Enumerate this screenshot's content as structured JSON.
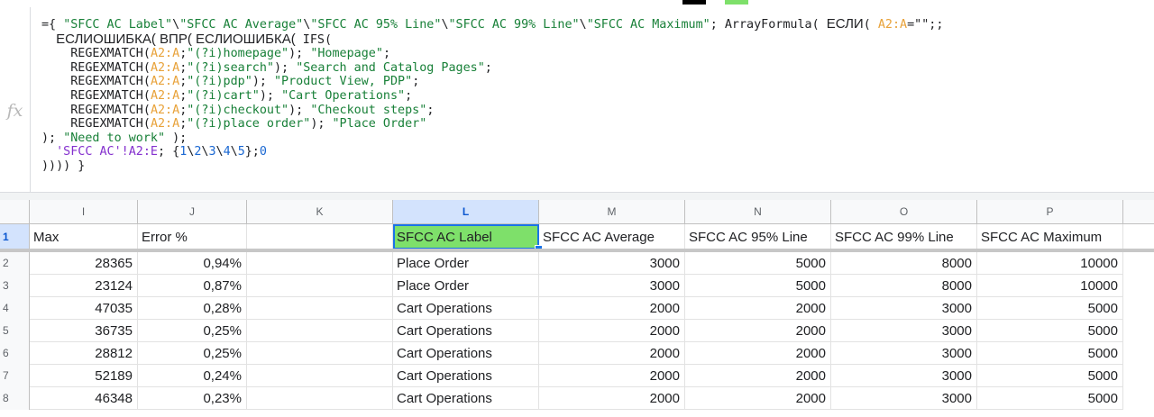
{
  "toolbar": {
    "marks": [
      {
        "name": "toolbar-black-swatch",
        "color": "#000000"
      },
      {
        "name": "toolbar-green-swatch",
        "color": "#7ee06a"
      }
    ]
  },
  "formula_bar": {
    "fx_label": "fx",
    "lines": [
      [
        {
          "t": "={ "
        },
        {
          "t": "\"SFCC AC Label\"",
          "c": "str"
        },
        {
          "t": "\\"
        },
        {
          "t": "\"SFCC AC Average\"",
          "c": "str"
        },
        {
          "t": "\\"
        },
        {
          "t": "\"SFCC AC 95% Line\"",
          "c": "str"
        },
        {
          "t": "\\"
        },
        {
          "t": "\"SFCC AC 99% Line\"",
          "c": "str"
        },
        {
          "t": "\\"
        },
        {
          "t": "\"SFCC AC Maximum\"",
          "c": "str"
        },
        {
          "t": "; ArrayFormula( "
        },
        {
          "t": "ЕСЛИ",
          "c": "cy"
        },
        {
          "t": "( "
        },
        {
          "t": "A2:A",
          "c": "ref"
        },
        {
          "t": "=\"\";;"
        }
      ],
      [
        {
          "t": "  "
        },
        {
          "t": "ЕСЛИОШИБКА( ВПР( ЕСЛИОШИБКА(",
          "c": "cy"
        },
        {
          "t": " IFS("
        }
      ],
      [
        {
          "t": "    REGEXMATCH("
        },
        {
          "t": "A2:A",
          "c": "ref"
        },
        {
          "t": ";"
        },
        {
          "t": "\"(?i)homepage\"",
          "c": "str"
        },
        {
          "t": "); "
        },
        {
          "t": "\"Homepage\"",
          "c": "str"
        },
        {
          "t": ";"
        }
      ],
      [
        {
          "t": "    REGEXMATCH("
        },
        {
          "t": "A2:A",
          "c": "ref"
        },
        {
          "t": ";"
        },
        {
          "t": "\"(?i)search\"",
          "c": "str"
        },
        {
          "t": "); "
        },
        {
          "t": "\"Search and Catalog Pages\"",
          "c": "str"
        },
        {
          "t": ";"
        }
      ],
      [
        {
          "t": "    REGEXMATCH("
        },
        {
          "t": "A2:A",
          "c": "ref"
        },
        {
          "t": ";"
        },
        {
          "t": "\"(?i)pdp\"",
          "c": "str"
        },
        {
          "t": "); "
        },
        {
          "t": "\"Product View, PDP\"",
          "c": "str"
        },
        {
          "t": ";"
        }
      ],
      [
        {
          "t": "    REGEXMATCH("
        },
        {
          "t": "A2:A",
          "c": "ref"
        },
        {
          "t": ";"
        },
        {
          "t": "\"(?i)cart\"",
          "c": "str"
        },
        {
          "t": "); "
        },
        {
          "t": "\"Cart Operations\"",
          "c": "str"
        },
        {
          "t": ";"
        }
      ],
      [
        {
          "t": "    REGEXMATCH("
        },
        {
          "t": "A2:A",
          "c": "ref"
        },
        {
          "t": ";"
        },
        {
          "t": "\"(?i)checkout\"",
          "c": "str"
        },
        {
          "t": "); "
        },
        {
          "t": "\"Checkout steps\"",
          "c": "str"
        },
        {
          "t": ";"
        }
      ],
      [
        {
          "t": "    REGEXMATCH("
        },
        {
          "t": "A2:A",
          "c": "ref"
        },
        {
          "t": ";"
        },
        {
          "t": "\"(?i)place order\"",
          "c": "str"
        },
        {
          "t": "); "
        },
        {
          "t": "\"Place Order\"",
          "c": "str"
        }
      ],
      [
        {
          "t": "); "
        },
        {
          "t": "\"Need to work\"",
          "c": "str"
        },
        {
          "t": " );"
        }
      ],
      [
        {
          "t": "  "
        },
        {
          "t": "'SFCC AC'!A2:E",
          "c": "sheet"
        },
        {
          "t": "; {"
        },
        {
          "t": "1",
          "c": "num"
        },
        {
          "t": "\\"
        },
        {
          "t": "2",
          "c": "num"
        },
        {
          "t": "\\"
        },
        {
          "t": "3",
          "c": "num"
        },
        {
          "t": "\\"
        },
        {
          "t": "4",
          "c": "num"
        },
        {
          "t": "\\"
        },
        {
          "t": "5",
          "c": "num"
        },
        {
          "t": "};"
        },
        {
          "t": "0",
          "c": "num"
        }
      ],
      [
        {
          "t": ")))) }"
        }
      ]
    ]
  },
  "sheet": {
    "columns": [
      {
        "id": "I",
        "label": "I"
      },
      {
        "id": "J",
        "label": "J"
      },
      {
        "id": "K",
        "label": "K"
      },
      {
        "id": "L",
        "label": "L",
        "selected": true
      },
      {
        "id": "M",
        "label": "M"
      },
      {
        "id": "N",
        "label": "N"
      },
      {
        "id": "O",
        "label": "O"
      },
      {
        "id": "P",
        "label": "P"
      }
    ],
    "selected_cell": "L1",
    "selected_fill": "#7ee06a",
    "rows": [
      {
        "num": "1",
        "cells": [
          "Max",
          "Error %",
          "",
          "SFCC AC Label",
          "SFCC AC Average",
          "SFCC AC 95% Line",
          "SFCC AC 99% Line",
          "SFCC AC Maximum"
        ]
      },
      {
        "num": "2",
        "cells": [
          "28365",
          "0,94%",
          "",
          "Place Order",
          "3000",
          "5000",
          "8000",
          "10000"
        ]
      },
      {
        "num": "3",
        "cells": [
          "23124",
          "0,87%",
          "",
          "Place Order",
          "3000",
          "5000",
          "8000",
          "10000"
        ]
      },
      {
        "num": "4",
        "cells": [
          "47035",
          "0,28%",
          "",
          "Cart Operations",
          "2000",
          "2000",
          "3000",
          "5000"
        ]
      },
      {
        "num": "5",
        "cells": [
          "36735",
          "0,25%",
          "",
          "Cart Operations",
          "2000",
          "2000",
          "3000",
          "5000"
        ]
      },
      {
        "num": "6",
        "cells": [
          "28812",
          "0,25%",
          "",
          "Cart Operations",
          "2000",
          "2000",
          "3000",
          "5000"
        ]
      },
      {
        "num": "7",
        "cells": [
          "52189",
          "0,24%",
          "",
          "Cart Operations",
          "2000",
          "2000",
          "3000",
          "5000"
        ]
      },
      {
        "num": "8",
        "cells": [
          "46348",
          "0,23%",
          "",
          "Cart Operations",
          "2000",
          "2000",
          "3000",
          "5000"
        ]
      }
    ]
  }
}
